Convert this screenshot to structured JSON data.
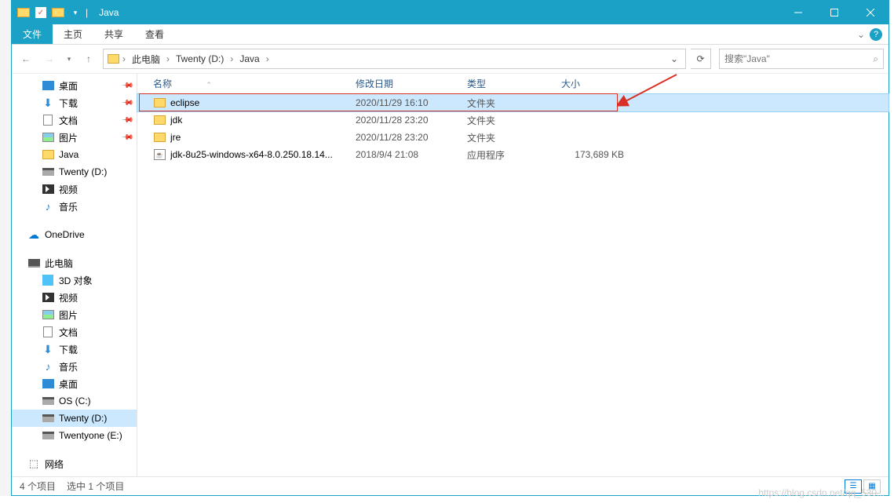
{
  "window": {
    "title": "Java"
  },
  "ribbon": {
    "file": "文件",
    "tabs": [
      "主页",
      "共享",
      "查看"
    ]
  },
  "address": {
    "crumbs": [
      "此电脑",
      "Twenty (D:)",
      "Java"
    ]
  },
  "search": {
    "placeholder": "搜索\"Java\"",
    "icon_label": "搜索"
  },
  "nav_quick": [
    {
      "label": "桌面",
      "icon": "desktop",
      "pin": true
    },
    {
      "label": "下载",
      "icon": "download",
      "pin": true
    },
    {
      "label": "文档",
      "icon": "doc",
      "pin": true
    },
    {
      "label": "图片",
      "icon": "pic",
      "pin": true
    },
    {
      "label": "Java",
      "icon": "folder",
      "pin": false
    },
    {
      "label": "Twenty (D:)",
      "icon": "drive",
      "pin": false
    },
    {
      "label": "视频",
      "icon": "video",
      "pin": false
    },
    {
      "label": "音乐",
      "icon": "music",
      "pin": false
    }
  ],
  "nav_onedrive": {
    "label": "OneDrive"
  },
  "nav_pc": {
    "label": "此电脑",
    "children": [
      {
        "label": "3D 对象",
        "icon": "3d"
      },
      {
        "label": "视频",
        "icon": "video"
      },
      {
        "label": "图片",
        "icon": "pic"
      },
      {
        "label": "文档",
        "icon": "doc"
      },
      {
        "label": "下载",
        "icon": "download"
      },
      {
        "label": "音乐",
        "icon": "music"
      },
      {
        "label": "桌面",
        "icon": "desktop"
      },
      {
        "label": "OS (C:)",
        "icon": "drive"
      },
      {
        "label": "Twenty (D:)",
        "icon": "drive",
        "selected": true
      },
      {
        "label": "Twentyone (E:)",
        "icon": "drive"
      }
    ]
  },
  "nav_net": {
    "label": "网络"
  },
  "columns": {
    "name": "名称",
    "date": "修改日期",
    "type": "类型",
    "size": "大小"
  },
  "files": [
    {
      "name": "eclipse",
      "date": "2020/11/29 16:10",
      "type": "文件夹",
      "size": "",
      "icon": "folder",
      "selected": true
    },
    {
      "name": "jdk",
      "date": "2020/11/28 23:20",
      "type": "文件夹",
      "size": "",
      "icon": "folder"
    },
    {
      "name": "jre",
      "date": "2020/11/28 23:20",
      "type": "文件夹",
      "size": "",
      "icon": "folder"
    },
    {
      "name": "jdk-8u25-windows-x64-8.0.250.18.14...",
      "date": "2018/9/4 21:08",
      "type": "应用程序",
      "size": "173,689 KB",
      "icon": "java"
    }
  ],
  "status": {
    "count": "4 个项目",
    "selected": "选中 1 个项目"
  },
  "watermark": "https://blog.csdn.net/qq_530..."
}
